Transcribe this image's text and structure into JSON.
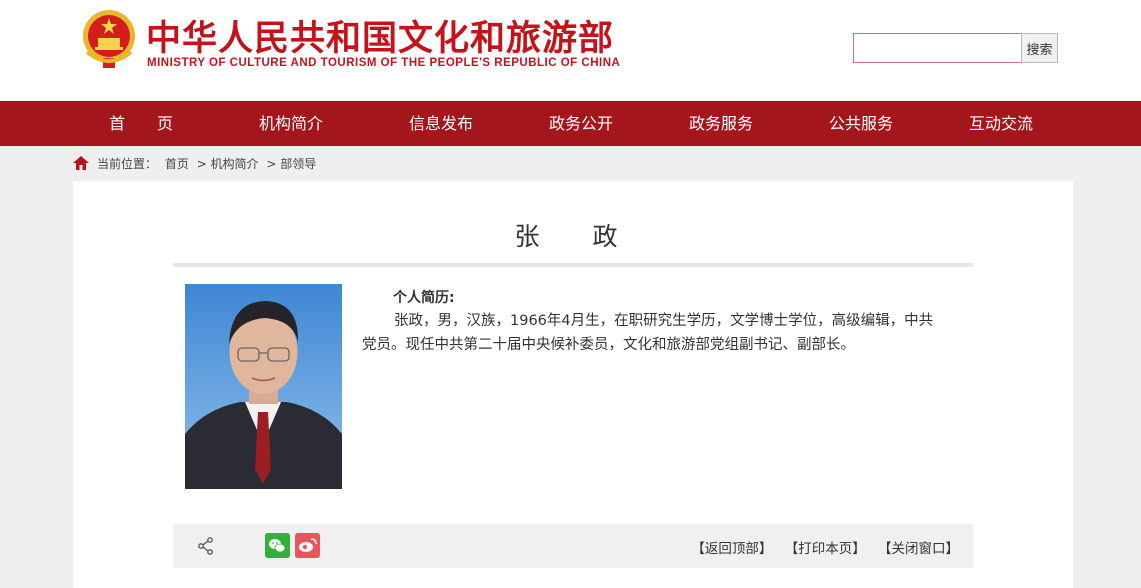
{
  "header": {
    "title": "中华人民共和国文化和旅游部",
    "subtitle": "MINISTRY OF CULTURE AND TOURISM OF THE PEOPLE'S REPUBLIC OF CHINA",
    "emblem_icon": "national-emblem-icon",
    "search_placeholder": "",
    "search_button": "搜索"
  },
  "nav": {
    "items": [
      "首　　页",
      "机构简介",
      "信息发布",
      "政务公开",
      "政务服务",
      "公共服务",
      "互动交流"
    ]
  },
  "breadcrumb": {
    "label": "当前位置：",
    "items": [
      "首页",
      "> 机构简介",
      "> 部领导"
    ]
  },
  "profile": {
    "name": "张　政",
    "bio_heading": "个人简历:",
    "bio_text": "张政，男，汉族，1966年4月生，在职研究生学历，文学博士学位，高级编辑，中共党员。现任中共第二十届中央候补委员，文化和旅游部党组副书记、副部长。"
  },
  "footer": {
    "links": [
      "【返回顶部】",
      "【打印本页】",
      "【关闭窗口】"
    ]
  },
  "colors": {
    "brand_red": "#c4141b",
    "nav_red": "#a3161c",
    "wechat_green": "#32b03a",
    "weibo_red": "#e8565b"
  }
}
